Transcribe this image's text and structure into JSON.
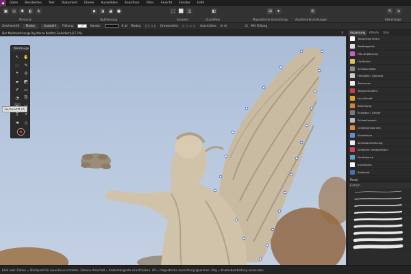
{
  "menubar": {
    "items": [
      "Datei",
      "Bearbeiten",
      "Text",
      "Dokument",
      "Ebene",
      "Auswählen",
      "Anordnen",
      "Filter",
      "Ansicht",
      "Fenster",
      "Hilfe"
    ]
  },
  "toolbar": {
    "labels": {
      "personas": "Personas",
      "optimierung": "Optimierung",
      "auswahl": "Auswahl",
      "quickmask": "QuickMask",
      "magnetische": "Magnetische Ausrichtung",
      "assistent": "Assistent-Einstellungen",
      "reihenfolge": "Reihenfolge"
    }
  },
  "contextbar": {
    "tool_name": "Zeichenstift",
    "mask_btn": "Maske",
    "select_btn": "Auswahl",
    "fill_label": "Füllung:",
    "contour_label": "Kontur:",
    "contour_value": "0 pt",
    "mode_label": "Modus:",
    "convert_label": "Umwandeln:",
    "align_label": "Ausrichten:",
    "fill_check": "Mit Füllung"
  },
  "document": {
    "title": "Der Mellmanfrisongel by Marco Kolditz [Geändert] (57.2%)"
  },
  "toolpanel": {
    "title": "Werkzeuge",
    "tooltip": "Zeichenstift (P)"
  },
  "rpanel": {
    "tabs": [
      "Anpassung",
      "Effekte",
      "Stile"
    ],
    "adjustments": [
      {
        "label": "Tonwertkorrektur",
        "color": "#ffffff"
      },
      {
        "label": "Weißabgleich",
        "color": "#dddddd"
      },
      {
        "label": "HSL-Anpassung",
        "color": "#c85ec8"
      },
      {
        "label": "Umfärben",
        "color": "#e0c060"
      },
      {
        "label": "Schwarz-Weiß",
        "color": "#888888"
      },
      {
        "label": "Helligkeit / Kontrast",
        "color": "#cccccc"
      },
      {
        "label": "Tonkurven",
        "color": "#eeeeee"
      },
      {
        "label": "Tonwertumkehr",
        "color": "#c84040"
      },
      {
        "label": "Leuchtkraft",
        "color": "#e0a030"
      },
      {
        "label": "Belichtung",
        "color": "#d08040"
      },
      {
        "label": "Schatten / Lichter",
        "color": "#777777"
      },
      {
        "label": "Schwellenwert",
        "color": "#bbbbbb"
      },
      {
        "label": "Gradationskurven",
        "color": "#dd8844"
      },
      {
        "label": "Kanalmixer",
        "color": "#6090d0"
      },
      {
        "label": "Verlaufsumsetzung",
        "color": "#eeeeee"
      },
      {
        "label": "Selektive Farbkorrektur",
        "color": "#d44060"
      },
      {
        "label": "Farbbalance",
        "color": "#60a0d0"
      },
      {
        "label": "Invertieren",
        "color": "#ffffff"
      },
      {
        "label": "Softproof",
        "color": "#4070c0"
      }
    ],
    "brush_header": "Pinsel",
    "brush_category": "Einfach"
  },
  "status": {
    "text": "Klick oder Ziehen = Startpunkt für neue Kurve erstellen. Ziehen+Umschalt = Knotentangente einschränken. Alt = magnetische Ausrichtung ignorieren. Strg = Knotenbearbeitung verwenden."
  }
}
